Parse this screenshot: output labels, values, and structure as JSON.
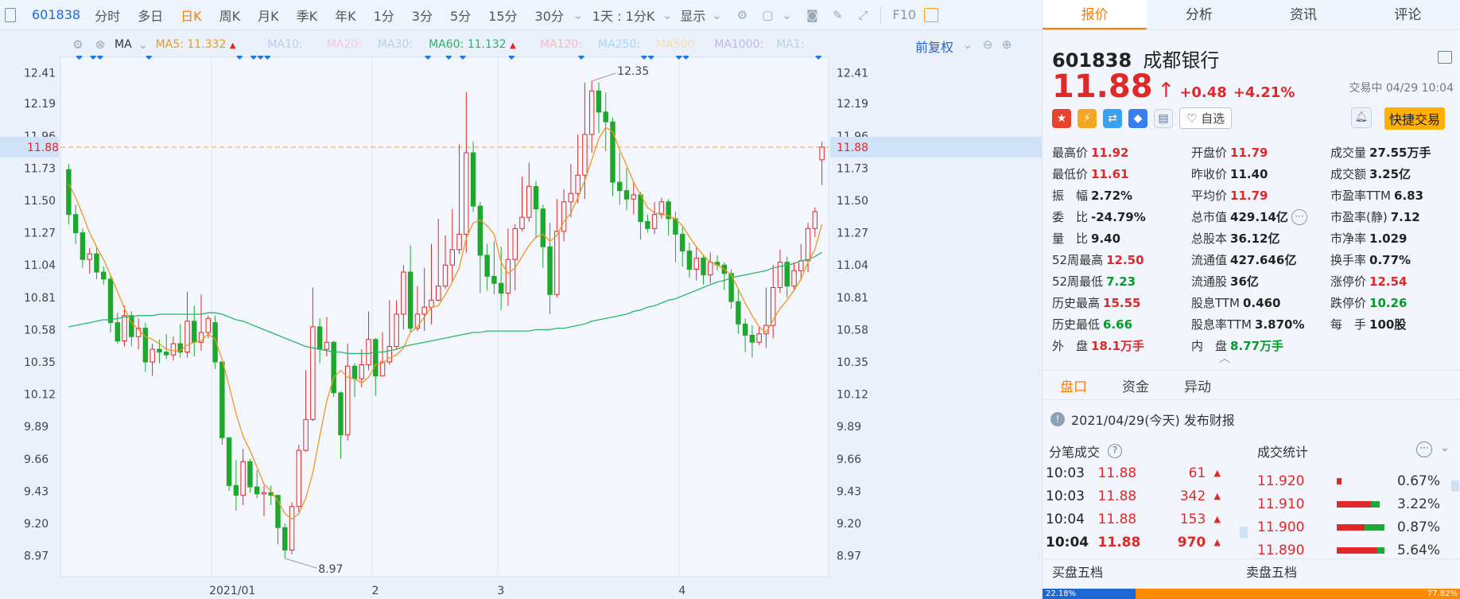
{
  "toolbar": {
    "code": "601838",
    "items": [
      "分时",
      "多日",
      "日K",
      "周K",
      "月K",
      "季K",
      "年K",
      "1分",
      "3分",
      "5分",
      "15分",
      "30分"
    ],
    "active": "日K",
    "interval": "1天 : 1分K",
    "display": "显示",
    "f10": "F10"
  },
  "ma_row": {
    "label": "MA",
    "ma5": "MA5: 11.332",
    "ma10": "MA10:",
    "ma20": "MA20:",
    "ma30": "MA30:",
    "ma60": "MA60: 11.132",
    "ma120": "MA120:",
    "ma250": "MA250:",
    "ma500": "MA500:",
    "ma1000": "MA1000:",
    "ma1": "MA1:",
    "fuquan": "前复权"
  },
  "chart_data": {
    "type": "candlestick",
    "y_ticks": [
      "12.41",
      "12.19",
      "11.96",
      "11.73",
      "11.50",
      "11.27",
      "11.04",
      "10.81",
      "10.58",
      "10.35",
      "10.12",
      "9.89",
      "9.66",
      "9.43",
      "9.20",
      "8.97"
    ],
    "ylim": [
      8.82,
      12.52
    ],
    "current_price": "11.88",
    "high_label": "12.35",
    "low_label": "8.97",
    "x_labels": [
      "2021/01",
      "2",
      "3",
      "4"
    ],
    "candles": [
      [
        11.72,
        11.4,
        11.76,
        11.33
      ],
      [
        11.4,
        11.27,
        11.47,
        11.19
      ],
      [
        11.27,
        11.08,
        11.3,
        11.02
      ],
      [
        11.08,
        11.12,
        11.16,
        10.98
      ],
      [
        11.12,
        10.99,
        11.16,
        10.94
      ],
      [
        10.99,
        10.94,
        11.03,
        10.9
      ],
      [
        10.94,
        10.63,
        10.97,
        10.56
      ],
      [
        10.63,
        10.5,
        10.7,
        10.48
      ],
      [
        10.5,
        10.68,
        10.75,
        10.46
      ],
      [
        10.68,
        10.53,
        10.71,
        10.46
      ],
      [
        10.53,
        10.59,
        10.66,
        10.44
      ],
      [
        10.59,
        10.35,
        10.63,
        10.28
      ],
      [
        10.35,
        10.44,
        10.48,
        10.25
      ],
      [
        10.44,
        10.42,
        10.51,
        10.34
      ],
      [
        10.42,
        10.4,
        10.55,
        10.37
      ],
      [
        10.4,
        10.48,
        10.53,
        10.36
      ],
      [
        10.48,
        10.42,
        10.62,
        10.38
      ],
      [
        10.42,
        10.64,
        10.85,
        10.38
      ],
      [
        10.64,
        10.49,
        10.75,
        10.39
      ],
      [
        10.49,
        10.56,
        10.83,
        10.43
      ],
      [
        10.56,
        10.66,
        10.68,
        10.52
      ],
      [
        10.63,
        10.35,
        10.68,
        10.3
      ],
      [
        10.35,
        9.81,
        10.35,
        9.76
      ],
      [
        9.81,
        9.47,
        9.81,
        9.43
      ],
      [
        9.47,
        9.4,
        9.65,
        9.29
      ],
      [
        9.4,
        9.64,
        9.73,
        9.33
      ],
      [
        9.64,
        9.46,
        9.66,
        9.42
      ],
      [
        9.46,
        9.41,
        9.58,
        9.38
      ],
      [
        9.41,
        9.42,
        9.47,
        9.25
      ],
      [
        9.42,
        9.4,
        9.47,
        9.33
      ],
      [
        9.4,
        9.17,
        9.4,
        9.05
      ],
      [
        9.17,
        9.01,
        9.2,
        8.95
      ],
      [
        9.01,
        9.32,
        9.35,
        8.98
      ],
      [
        9.32,
        9.72,
        9.76,
        9.28
      ],
      [
        9.72,
        9.94,
        10.29,
        9.71
      ],
      [
        9.94,
        10.6,
        10.88,
        9.93
      ],
      [
        10.6,
        10.44,
        10.66,
        10.34
      ],
      [
        10.44,
        10.49,
        10.67,
        10.39
      ],
      [
        10.49,
        10.13,
        10.5,
        10.1
      ],
      [
        10.13,
        9.83,
        10.14,
        9.66
      ],
      [
        9.83,
        10.32,
        10.48,
        9.79
      ],
      [
        10.32,
        10.23,
        10.34,
        10.1
      ],
      [
        10.23,
        10.33,
        10.44,
        10.17
      ],
      [
        10.33,
        10.51,
        10.71,
        10.29
      ],
      [
        10.51,
        10.25,
        10.52,
        10.11
      ],
      [
        10.25,
        10.35,
        10.56,
        10.3
      ],
      [
        10.35,
        10.46,
        10.79,
        10.33
      ],
      [
        10.46,
        10.69,
        10.79,
        10.44
      ],
      [
        10.69,
        10.99,
        11.04,
        10.58
      ],
      [
        10.99,
        10.59,
        11.18,
        10.56
      ],
      [
        10.59,
        10.69,
        10.89,
        10.57
      ],
      [
        10.69,
        10.74,
        11.02,
        10.57
      ],
      [
        10.74,
        10.79,
        11.19,
        10.62
      ],
      [
        10.79,
        10.89,
        11.37,
        10.78
      ],
      [
        10.89,
        11.04,
        11.25,
        10.87
      ],
      [
        11.04,
        11.15,
        11.44,
        10.92
      ],
      [
        11.15,
        11.26,
        11.9,
        11.12
      ],
      [
        11.26,
        11.84,
        12.27,
        11.13
      ],
      [
        11.84,
        11.46,
        11.92,
        11.42
      ],
      [
        11.46,
        11.11,
        11.49,
        10.84
      ],
      [
        11.11,
        10.96,
        11.19,
        10.86
      ],
      [
        10.96,
        10.91,
        11.21,
        10.83
      ],
      [
        10.91,
        10.84,
        11.17,
        10.72
      ],
      [
        10.84,
        11.08,
        11.3,
        10.75
      ],
      [
        11.08,
        11.3,
        11.33,
        10.86
      ],
      [
        11.3,
        11.38,
        11.67,
        11.28
      ],
      [
        11.38,
        11.6,
        11.77,
        11.35
      ],
      [
        11.6,
        11.44,
        11.64,
        11.23
      ],
      [
        11.44,
        11.17,
        11.47,
        11.02
      ],
      [
        11.17,
        10.83,
        11.34,
        10.69
      ],
      [
        10.83,
        11.28,
        11.51,
        10.81
      ],
      [
        11.28,
        11.49,
        11.58,
        11.21
      ],
      [
        11.49,
        11.55,
        11.76,
        11.38
      ],
      [
        11.55,
        11.68,
        11.97,
        11.48
      ],
      [
        11.68,
        11.97,
        12.34,
        11.51
      ],
      [
        11.97,
        12.28,
        12.35,
        11.84
      ],
      [
        12.28,
        12.13,
        12.34,
        11.98
      ],
      [
        12.13,
        12.06,
        12.27,
        11.85
      ],
      [
        12.06,
        11.63,
        12.09,
        11.53
      ],
      [
        11.63,
        11.57,
        11.84,
        11.47
      ],
      [
        11.57,
        11.51,
        11.73,
        11.43
      ],
      [
        11.51,
        11.54,
        11.63,
        11.4
      ],
      [
        11.54,
        11.35,
        11.56,
        11.22
      ],
      [
        11.35,
        11.3,
        11.4,
        11.27
      ],
      [
        11.3,
        11.4,
        11.49,
        11.26
      ],
      [
        11.4,
        11.49,
        11.52,
        11.37
      ],
      [
        11.49,
        11.37,
        11.51,
        11.25
      ],
      [
        11.37,
        11.26,
        11.42,
        11.06
      ],
      [
        11.26,
        11.14,
        11.31,
        11.03
      ],
      [
        11.14,
        11.01,
        11.2,
        10.95
      ],
      [
        11.01,
        11.09,
        11.17,
        10.93
      ],
      [
        11.09,
        10.97,
        11.11,
        10.9
      ],
      [
        10.97,
        11.06,
        11.13,
        10.91
      ],
      [
        11.06,
        11.04,
        11.11,
        11.0
      ],
      [
        11.04,
        10.98,
        11.06,
        10.86
      ],
      [
        10.98,
        10.78,
        11.01,
        10.73
      ],
      [
        10.78,
        10.62,
        10.87,
        10.55
      ],
      [
        10.62,
        10.54,
        10.66,
        10.42
      ],
      [
        10.54,
        10.49,
        10.61,
        10.38
      ],
      [
        10.49,
        10.55,
        10.6,
        10.47
      ],
      [
        10.55,
        10.61,
        10.88,
        10.45
      ],
      [
        10.61,
        10.88,
        11.04,
        10.52
      ],
      [
        10.88,
        11.06,
        11.15,
        10.84
      ],
      [
        11.06,
        10.89,
        11.1,
        10.81
      ],
      [
        10.89,
        11.0,
        11.06,
        10.86
      ],
      [
        11.0,
        11.07,
        11.19,
        10.93
      ],
      [
        11.07,
        11.3,
        11.34,
        10.99
      ],
      [
        11.3,
        11.42,
        11.45,
        11.24
      ],
      [
        11.79,
        11.88,
        11.92,
        11.61
      ]
    ],
    "ma5": [
      11.62,
      11.52,
      11.4,
      11.27,
      11.17,
      11.08,
      10.97,
      10.85,
      10.73,
      10.63,
      10.58,
      10.53,
      10.51,
      10.48,
      10.44,
      10.43,
      10.43,
      10.47,
      10.49,
      10.5,
      10.55,
      10.51,
      10.37,
      10.18,
      9.98,
      9.82,
      9.72,
      9.6,
      9.48,
      9.43,
      9.36,
      9.27,
      9.23,
      9.27,
      9.38,
      9.56,
      9.82,
      10.07,
      10.24,
      10.29,
      10.24,
      10.23,
      10.2,
      10.24,
      10.33,
      10.34,
      10.38,
      10.4,
      10.45,
      10.56,
      10.6,
      10.67,
      10.74,
      10.75,
      10.83,
      10.92,
      11.02,
      11.23,
      11.34,
      11.36,
      11.32,
      11.26,
      11.06,
      10.98,
      11.02,
      11.1,
      11.18,
      11.24,
      11.26,
      11.21,
      11.25,
      11.35,
      11.41,
      11.52,
      11.64,
      11.79,
      11.94,
      12.02,
      11.99,
      11.86,
      11.75,
      11.63,
      11.54,
      11.45,
      11.41,
      11.41,
      11.39,
      11.37,
      11.32,
      11.24,
      11.17,
      11.11,
      11.06,
      11.04,
      11.01,
      10.97,
      10.87,
      10.77,
      10.68,
      10.6,
      10.56,
      10.65,
      10.73,
      10.79,
      10.86,
      10.94,
      11.06,
      11.15,
      11.33
    ],
    "ma60": [
      10.6,
      10.61,
      10.62,
      10.63,
      10.64,
      10.65,
      10.65,
      10.66,
      10.67,
      10.67,
      10.68,
      10.68,
      10.68,
      10.69,
      10.69,
      10.69,
      10.69,
      10.69,
      10.69,
      10.69,
      10.7,
      10.7,
      10.69,
      10.67,
      10.65,
      10.64,
      10.62,
      10.6,
      10.58,
      10.56,
      10.54,
      10.52,
      10.5,
      10.48,
      10.46,
      10.45,
      10.44,
      10.43,
      10.42,
      10.42,
      10.41,
      10.41,
      10.41,
      10.41,
      10.42,
      10.42,
      10.43,
      10.44,
      10.46,
      10.47,
      10.48,
      10.49,
      10.5,
      10.51,
      10.52,
      10.53,
      10.54,
      10.55,
      10.56,
      10.56,
      10.57,
      10.57,
      10.57,
      10.57,
      10.57,
      10.57,
      10.57,
      10.58,
      10.58,
      10.58,
      10.59,
      10.59,
      10.6,
      10.61,
      10.62,
      10.64,
      10.65,
      10.66,
      10.67,
      10.68,
      10.69,
      10.71,
      10.72,
      10.74,
      10.75,
      10.77,
      10.79,
      10.8,
      10.82,
      10.84,
      10.86,
      10.88,
      10.9,
      10.92,
      10.93,
      10.95,
      10.96,
      10.97,
      10.98,
      10.99,
      11.0,
      11.02,
      11.03,
      11.04,
      11.05,
      11.07,
      11.08,
      11.1,
      11.13
    ]
  },
  "panel": {
    "tabs": [
      "报价",
      "分析",
      "资讯",
      "评论"
    ],
    "code": "601838",
    "name": "成都银行",
    "price": "11.88",
    "change": "+0.48",
    "change_pct": "+4.21%",
    "status": "交易中 04/29 10:04",
    "zixuan": "自选",
    "quick_trade": "快捷交易",
    "quote": [
      [
        [
          "最高价",
          "11.92",
          "red"
        ],
        [
          "开盘价",
          "11.79",
          "red"
        ],
        [
          "成交量",
          "27.55万手",
          "black"
        ]
      ],
      [
        [
          "最低价",
          "11.61",
          "red"
        ],
        [
          "昨收价",
          "11.40",
          "black"
        ],
        [
          "成交额",
          "3.25亿",
          "black"
        ]
      ],
      [
        [
          "振　幅",
          "2.72%",
          "black"
        ],
        [
          "平均价",
          "11.79",
          "red"
        ],
        [
          "市盈率TTM",
          "6.83",
          "black"
        ]
      ],
      [
        [
          "委　比",
          "-24.79%",
          "black"
        ],
        [
          "总市值",
          "429.14亿",
          "black"
        ],
        [
          "市盈率(静)",
          "7.12",
          "black"
        ]
      ],
      [
        [
          "量　比",
          "9.40",
          "black"
        ],
        [
          "总股本",
          "36.12亿",
          "black"
        ],
        [
          "市净率",
          "1.029",
          "black"
        ]
      ],
      [
        [
          "52周最高",
          "12.50",
          "red"
        ],
        [
          "流通值",
          "427.646亿",
          "black"
        ],
        [
          "换手率",
          "0.77%",
          "black"
        ]
      ],
      [
        [
          "52周最低",
          "7.23",
          "green"
        ],
        [
          "流通股",
          "36亿",
          "black"
        ],
        [
          "涨停价",
          "12.54",
          "red"
        ]
      ],
      [
        [
          "历史最高",
          "15.55",
          "red"
        ],
        [
          "股息TTM",
          "0.460",
          "black"
        ],
        [
          "跌停价",
          "10.26",
          "green"
        ]
      ],
      [
        [
          "历史最低",
          "6.66",
          "green"
        ],
        [
          "股息率TTM",
          "3.870%",
          "black"
        ],
        [
          "每　手",
          "100股",
          "black"
        ]
      ],
      [
        [
          "外　盘",
          "18.1万手",
          "red"
        ],
        [
          "内　盘",
          "8.77万手",
          "green"
        ],
        [
          "",
          "",
          "black"
        ]
      ]
    ],
    "sub_tabs": [
      "盘口",
      "资金",
      "异动"
    ],
    "report": "2021/04/29(今天)  发布财报",
    "fbcj": "分笔成交",
    "cjtj": "成交统计",
    "trades": [
      [
        "10:03",
        "11.88",
        "61"
      ],
      [
        "10:03",
        "11.88",
        "342"
      ],
      [
        "10:04",
        "11.88",
        "153"
      ],
      [
        "10:04",
        "11.88",
        "970"
      ]
    ],
    "stats": [
      [
        "11.920",
        "0.67%",
        0.1,
        0.0
      ],
      [
        "11.910",
        "3.22%",
        0.72,
        0.18
      ],
      [
        "11.900",
        "0.87%",
        0.58,
        0.42
      ],
      [
        "11.890",
        "5.64%",
        0.85,
        0.15
      ]
    ],
    "buy5": "买盘五档",
    "sell5": "卖盘五档",
    "bottom_left_pct": "22.18%",
    "bottom_right_pct": "77.82%",
    "colors": {
      "up": "#e02828",
      "down": "#009d2b",
      "accent": "#ff7d00",
      "link": "#1e68d6"
    }
  }
}
